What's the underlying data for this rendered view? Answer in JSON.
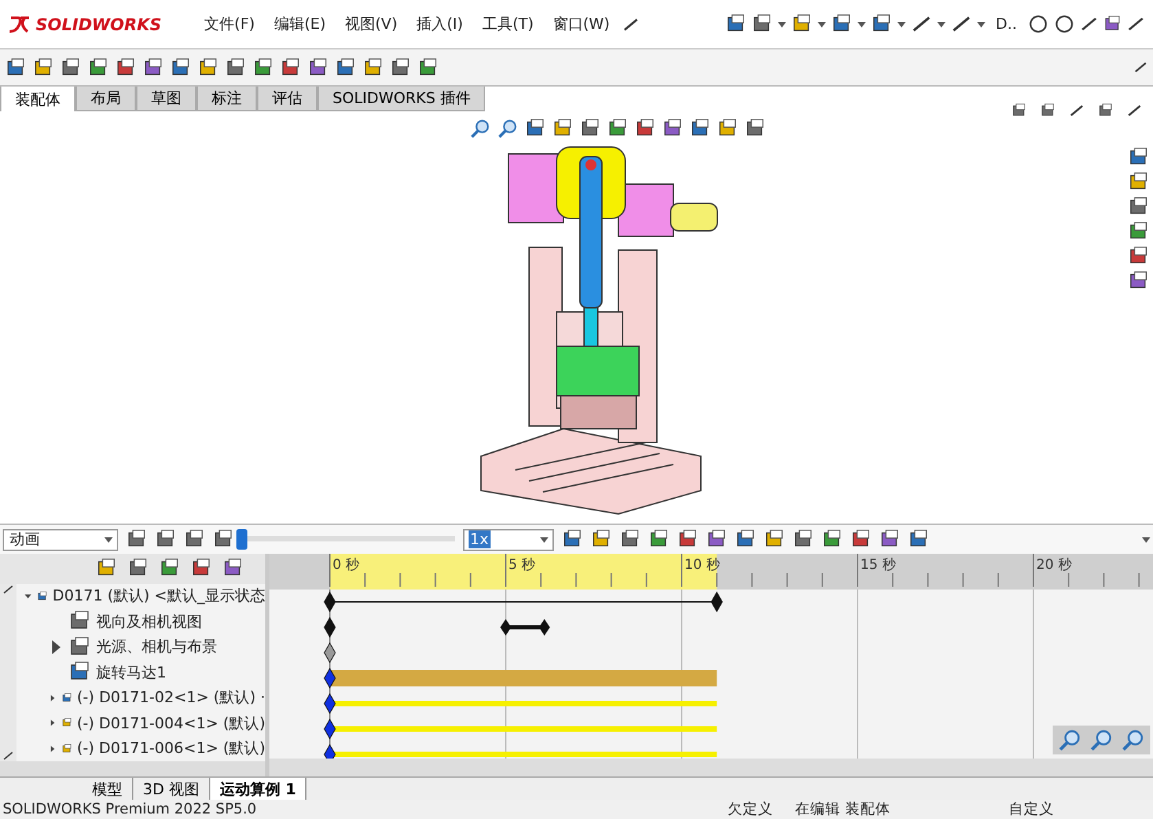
{
  "app": {
    "logo": "SOLIDWORKS",
    "menus": [
      "文件(F)",
      "编辑(E)",
      "视图(V)",
      "插入(I)",
      "工具(T)",
      "窗口(W)"
    ],
    "search": "D.."
  },
  "tabs": [
    {
      "label": "装配体",
      "selected": true
    },
    {
      "label": "布局",
      "selected": false
    },
    {
      "label": "草图",
      "selected": false
    },
    {
      "label": "标注",
      "selected": false
    },
    {
      "label": "评估",
      "selected": false
    },
    {
      "label": "SOLIDWORKS 插件",
      "selected": false
    }
  ],
  "motion": {
    "study_type": "动画",
    "speed": "1x",
    "time": {
      "level": 0
    },
    "ruler": [
      "0 秒",
      "5 秒",
      "10 秒",
      "15 秒",
      "20 秒"
    ],
    "tree": [
      {
        "label": "D0171 (默认) <默认_显示状态",
        "kind": "line",
        "expanded": true
      },
      {
        "label": "视向及相机视图",
        "kind": "span"
      },
      {
        "label": "光源、相机与布景",
        "kind": "key",
        "expanded": false
      },
      {
        "label": "旋转马达1",
        "kind": "bar"
      },
      {
        "label": "(-) D0171-02<1> (默认) ·",
        "kind": "thin",
        "expanded": false
      },
      {
        "label": "(-) D0171-004<1> (默认)",
        "kind": "thin",
        "expanded": false
      },
      {
        "label": "(-) D0171-006<1> (默认)",
        "kind": "thin",
        "expanded": false
      }
    ]
  },
  "bottom_tabs": [
    {
      "label": "模型",
      "selected": false
    },
    {
      "label": "3D 视图",
      "selected": false
    },
    {
      "label": "运动算例 1",
      "selected": true
    }
  ],
  "status": {
    "product": "SOLIDWORKS Premium 2022 SP5.0",
    "state": "欠定义",
    "mode": "在编辑 装配体",
    "units": "自定义"
  }
}
